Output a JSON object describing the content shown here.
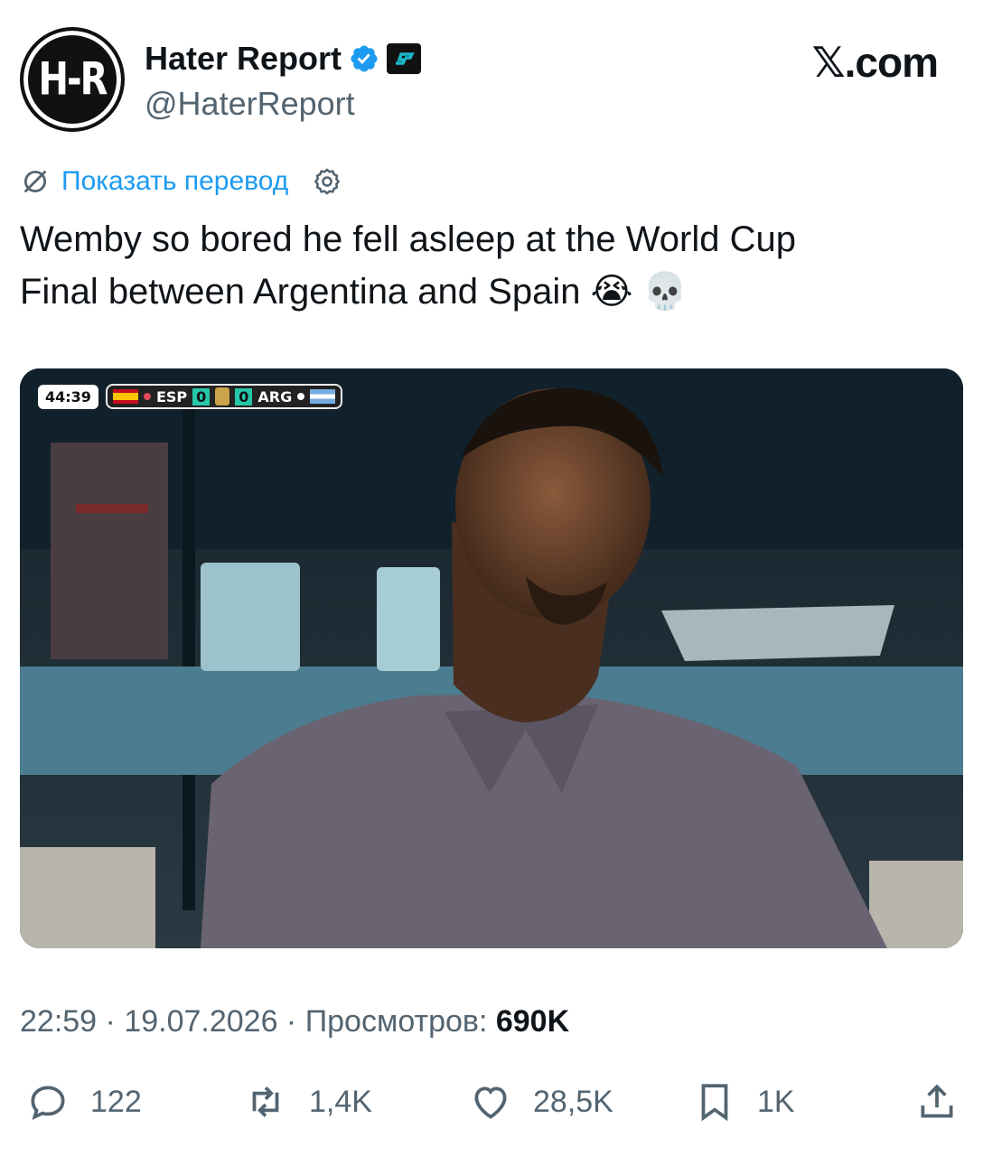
{
  "author": {
    "display_name": "Hater Report",
    "handle": "@HaterReport",
    "avatar_text": "H-R",
    "verified_icon": "verified-badge-icon",
    "affiliate_icon": "affiliate-badge-icon"
  },
  "site_label": "𝕏.com",
  "translate": {
    "label": "Показать перевод"
  },
  "tweet": {
    "text_line1": "Wemby so bored he fell asleep at the World Cup",
    "text_line2": "Final between Argentina and Spain 😭 💀"
  },
  "scoreboard": {
    "clock": "44:39",
    "team1": "ESP",
    "score1": "0",
    "score2": "0",
    "team2": "ARG"
  },
  "meta": {
    "time": "22:59",
    "sep1": " · ",
    "date": "19.07.2026",
    "sep2": " · ",
    "views_label": "Просмотров: ",
    "views_value": "690K"
  },
  "actions": {
    "replies": "122",
    "reposts": "1,4K",
    "likes": "28,5K",
    "bookmarks": "1K"
  },
  "colors": {
    "accent": "#1d9bf0",
    "text": "#0f1419",
    "secondary": "#536471"
  }
}
